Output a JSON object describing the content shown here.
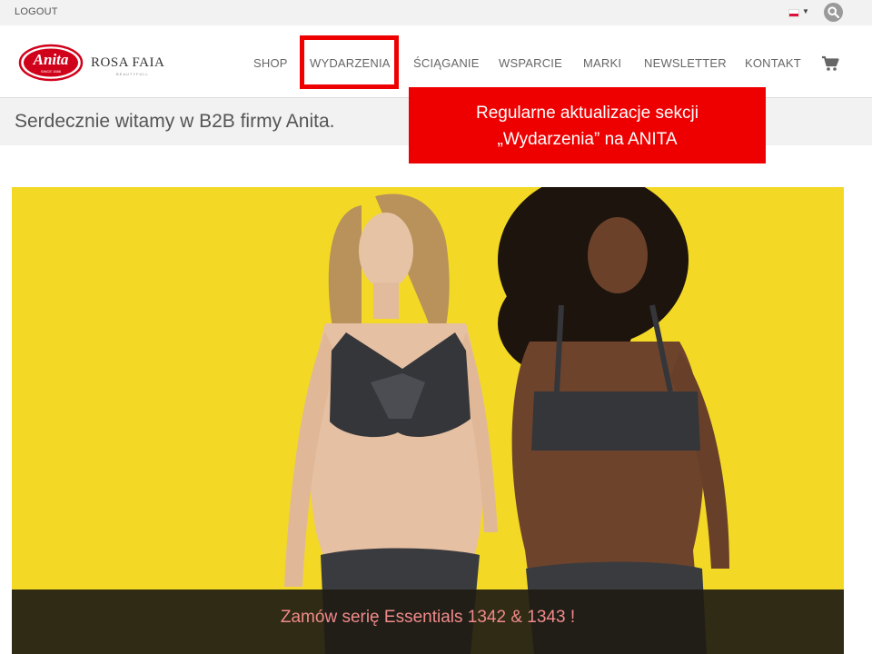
{
  "topbar": {
    "logout_label": "LOGOUT",
    "language_flag": "flag-pl-icon",
    "search_icon": "search-icon"
  },
  "brand": {
    "anita_logo_text": "Anita",
    "anita_logo_sub": "SINCE 1886",
    "rosa_faia_text": "ROSA FAIA",
    "rosa_faia_sub": "BEAUTYFULL"
  },
  "nav": {
    "items": [
      {
        "label": "SHOP"
      },
      {
        "label": "WYDARZENIA"
      },
      {
        "label": "ŚCIĄGANIE"
      },
      {
        "label": "WSPARCIE"
      },
      {
        "label": "MARKI"
      },
      {
        "label": "NEWSLETTER"
      },
      {
        "label": "KONTAKT"
      }
    ],
    "highlighted_item": "WYDARZENIA",
    "cart_icon": "cart-icon"
  },
  "welcome": {
    "text": "Serdecznie witamy w B2B firmy Anita."
  },
  "callout": {
    "line1": "Regularne aktualizacje sekcji",
    "line2": "„Wydarzenia” na ANITA"
  },
  "hero": {
    "caption": "Zamów serię Essentials 1342 & 1343 !"
  },
  "colors": {
    "accent_red": "#ee0000",
    "hero_background": "#f3d925",
    "caption_text": "#f08a8a"
  }
}
